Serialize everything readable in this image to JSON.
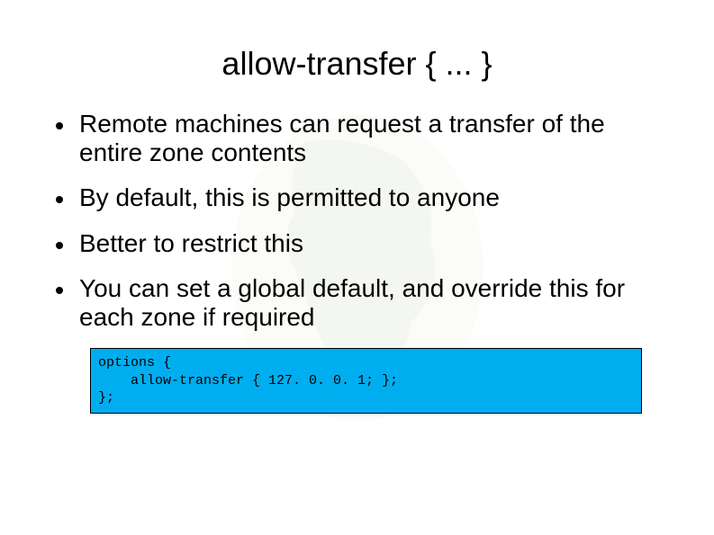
{
  "title": "allow-transfer { ... }",
  "bullets": [
    "Remote machines can request a transfer of the entire zone contents",
    "By default, this is permitted to anyone",
    "Better to restrict this",
    "You can set a global default, and override this for each zone if required"
  ],
  "code": "options {\n    allow-transfer { 127. 0. 0. 1; };\n};"
}
